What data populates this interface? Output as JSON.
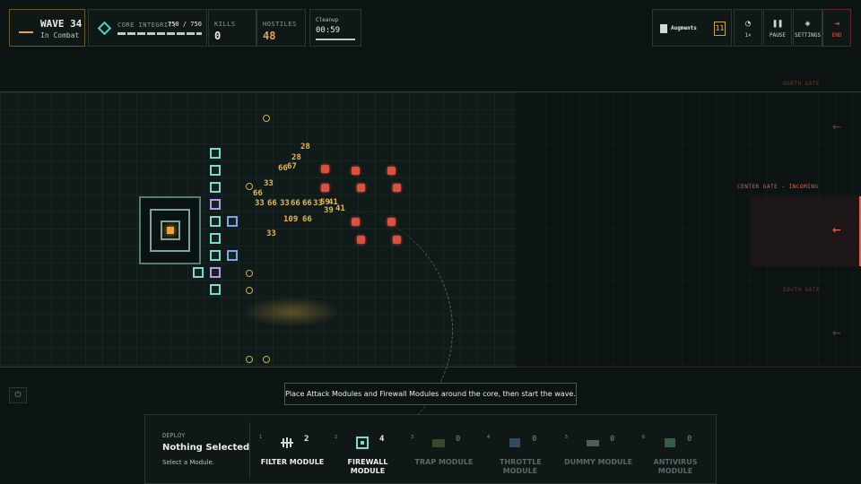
{
  "hud": {
    "wave": {
      "title": "WAVE 34",
      "status": "In Combat"
    },
    "core_integrity": {
      "label": "CORE INTEGRITY",
      "value": "750 / 750",
      "fraction": 1.0
    },
    "kills": {
      "label": "KILLS",
      "value": "0"
    },
    "hostiles": {
      "label": "HOSTILES",
      "value": "48"
    },
    "cleanup": {
      "label": "Cleanup",
      "value": "00:59"
    },
    "augments": {
      "label": "Augments",
      "count": "11"
    },
    "speed": {
      "label": "1×"
    },
    "pause": {
      "label": "PAUSE"
    },
    "settings": {
      "label": "SETTINGS"
    },
    "end": {
      "label": "END"
    }
  },
  "field": {
    "gates": {
      "north": "NORTH GATE",
      "center": "CENTER GATE - INCOMING",
      "south": "SOUTH GATE"
    },
    "damage_numbers": [
      "28",
      "28",
      "66",
      "67",
      "33",
      "66",
      "33",
      "66",
      "33",
      "66",
      "33",
      "66",
      "59",
      "41",
      "109",
      "66",
      "39",
      "41",
      "33"
    ]
  },
  "tip": "Place Attack Modules and Firewall Modules around the core, then start the wave.",
  "deploy": {
    "label": "DEPLOY",
    "selected": "Nothing Selected",
    "hint": "Select a Module.",
    "modules": [
      {
        "key": "1",
        "name": "FILTER MODULE",
        "count": "2",
        "enabled": true
      },
      {
        "key": "2",
        "name": "FIREWALL MODULE",
        "count": "4",
        "enabled": true
      },
      {
        "key": "3",
        "name": "TRAP MODULE",
        "count": "0",
        "enabled": false
      },
      {
        "key": "4",
        "name": "THROTTLE MODULE",
        "count": "0",
        "enabled": false
      },
      {
        "key": "5",
        "name": "DUMMY MODULE",
        "count": "0",
        "enabled": false
      },
      {
        "key": "6",
        "name": "ANTIVIRUS MODULE",
        "count": "0",
        "enabled": false
      }
    ]
  },
  "colors": {
    "accent": "#e0a93a",
    "danger": "#e56052",
    "friendly": "#7fd8cc"
  }
}
